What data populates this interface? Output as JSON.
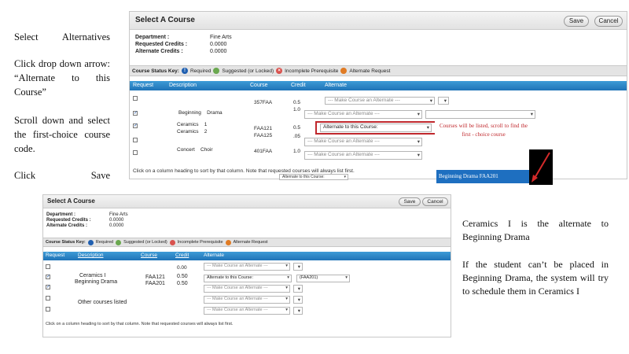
{
  "instructions": {
    "step1": "Select Alternatives",
    "step2": "Click drop down arrow: “Alternate to this Course”",
    "step3": "Scroll down and select the first-choice course code.",
    "step4": "Click Save"
  },
  "top_panel": {
    "title": "Select A Course",
    "save_label": "Save",
    "cancel_label": "Cancel",
    "dept_label": "Department :",
    "dept_value": "Fine Arts",
    "req_label": "Requested Credits :",
    "req_value": "0.0000",
    "alt_label": "Alternate Credits :",
    "alt_value": "0.0000",
    "key_title": "Course Status Key:",
    "key_required": "Required",
    "key_suggested": "Suggested (or Locked)",
    "key_incomplete": "Incomplete Prerequisite",
    "key_alternate": "Alternate Request",
    "headers": [
      "Request",
      "Description",
      "Course",
      "Credit",
      "Alternate"
    ],
    "rows": [
      {
        "course": "357FAA",
        "credit": "0.5",
        "select": "--- Make Course an Alternate ---"
      },
      {
        "desc1": "Beginning",
        "desc2": "Drama",
        "credit": "1.0",
        "select": "--- Make Course an Alternate ---"
      },
      {
        "desc1": "Ceramics",
        "desc1b": "1",
        "desc2": "Ceramics",
        "desc2b": "2",
        "course1": "FAA121",
        "course2": "FAA125",
        "credit1": "0.5",
        "credit2": ".05",
        "select": "Alternate to this Course:"
      },
      {
        "select": "--- Make Course an Alternate ---"
      },
      {
        "desc1": "Concert",
        "desc2": "Choir",
        "course": "401FAA",
        "credit": "1.0",
        "select": "--- Make Course an Alternate ---"
      }
    ],
    "footer_note": "Click on a column heading to sort by that column. Note that requested courses will always list first.",
    "bottom_select": "Alternate to this Course:",
    "callout": "Courses will be listed, scroll to find the first - choice course",
    "dropdown_option": "Beginning Drama FAA201"
  },
  "bottom_panel": {
    "title": "Select A Course",
    "save_label": "Save",
    "cancel_label": "Cancel",
    "dept_label": "Department :",
    "dept_value": "Fine Arts",
    "req_label": "Requested Credits :",
    "req_value": "0.0000",
    "alt_label": "Alternate Credits :",
    "alt_value": "0.0000",
    "key_title": "Course Status Key:",
    "key_required": "Required",
    "key_suggested": "Suggested (or Locked)",
    "key_incomplete": "Incomplete Prerequisite",
    "key_alternate": "Alternate Request",
    "headers": [
      "Request",
      "Description",
      "Course",
      "Credit",
      "Alternate"
    ],
    "desc_a": "Ceramics I",
    "desc_b": "Beginning Drama",
    "course_a": "FAA121",
    "course_b": "FAA201",
    "credit_0": "0.00",
    "credit_a": "0.50",
    "credit_b": "0.50",
    "other": "Other courses listed",
    "select_alt": "--- Make Course an Alternate ---",
    "select_alt_to": "Alternate to this Course:",
    "select_value": "(FAA201)",
    "footer_note": "Click on a column heading to sort by that column. Note that requested courses will always list first."
  },
  "explanation": {
    "line1": "Ceramics I is the alternate to Beginning Drama",
    "line2": "If the student can’t be placed in Beginning Drama, the system will try to schedule them in Ceramics I"
  },
  "colors": {
    "header_blue": "#2a86c8",
    "callout_red": "#c0282d",
    "option_blue": "#1e6fc0"
  }
}
